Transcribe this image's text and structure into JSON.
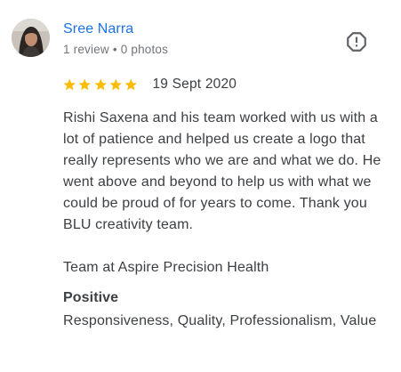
{
  "reviewer": {
    "name": "Sree Narra",
    "meta": "1 review • 0 photos"
  },
  "rating": {
    "stars": 5,
    "max_stars": 5,
    "date": "19 Sept 2020"
  },
  "review": {
    "paragraphs": [
      "Rishi Saxena and his team worked with us with a lot of patience and helped us create a logo that really represents who we are and what we do. He went above and beyond to help us with what we could be proud of for years to come. Thank you BLU creativity team.",
      "Team at Aspire Precision Health"
    ]
  },
  "positive": {
    "heading": "Positive",
    "values": "Responsiveness, Quality, Professionalism, Value"
  },
  "icons": {
    "report": "report-flag-icon",
    "star": "star-icon"
  },
  "colors": {
    "name_link": "#1a73e8",
    "star": "#fbbc04",
    "text": "#3c4043",
    "meta": "#70757a"
  }
}
